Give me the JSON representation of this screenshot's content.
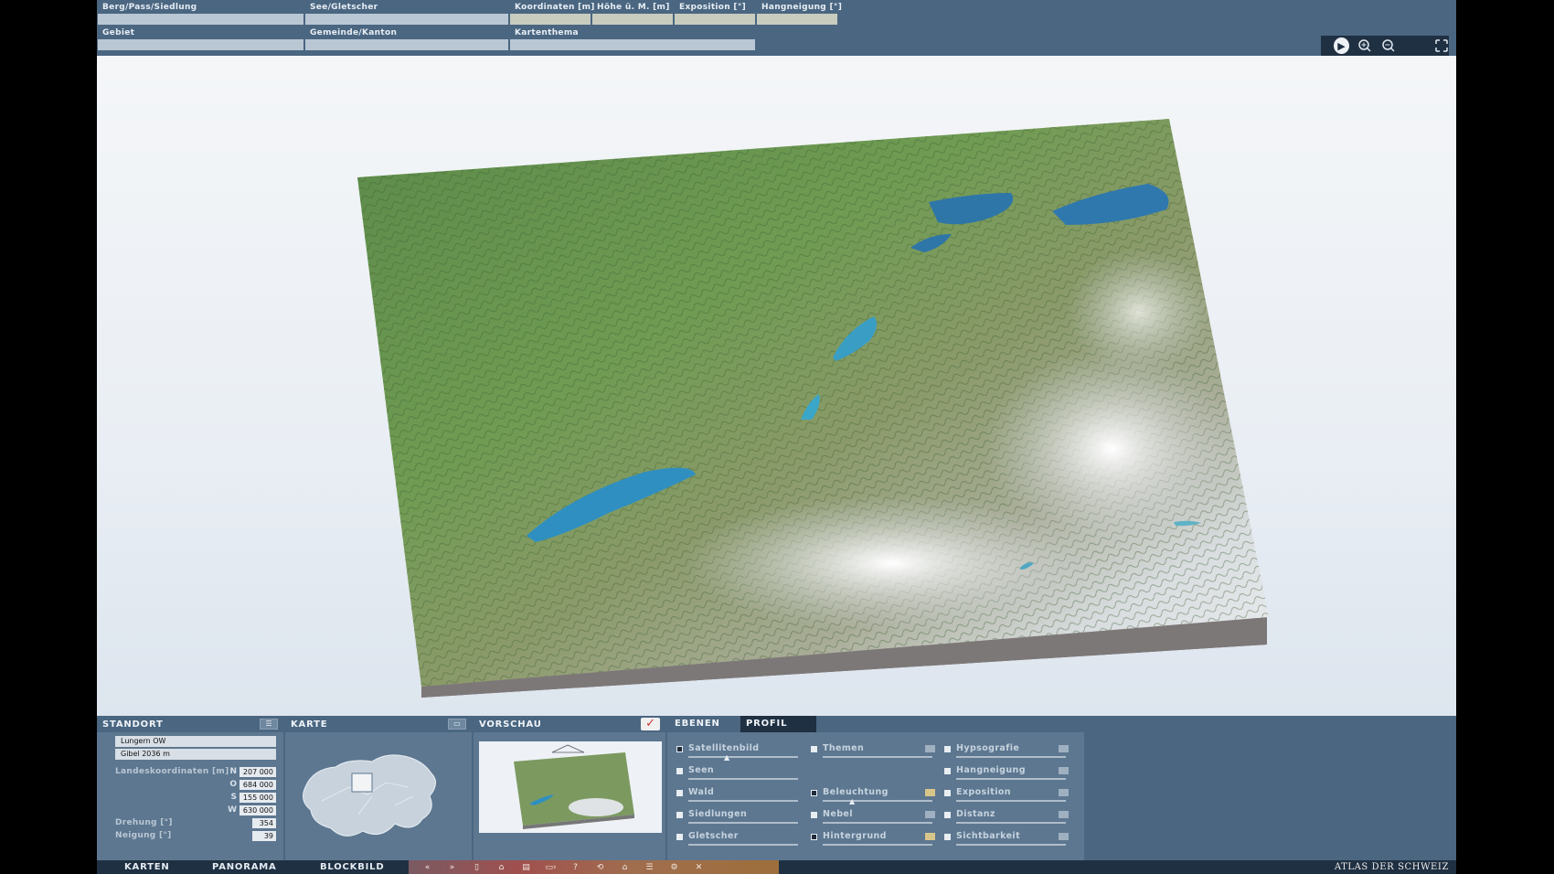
{
  "top": {
    "fields_row1": [
      {
        "label": "Berg/Pass/Siedlung"
      },
      {
        "label": "See/Gletscher"
      },
      {
        "label": "Koordinaten [m]"
      },
      {
        "label": "Höhe ü. M. [m]"
      },
      {
        "label": "Exposition [°]"
      },
      {
        "label": "Hangneigung [°]"
      }
    ],
    "fields_row2": [
      {
        "label": "Gebiet"
      },
      {
        "label": "Gemeinde/Kanton"
      },
      {
        "label": "Kartenthema"
      }
    ],
    "tools": [
      "play-icon",
      "zoom-in-icon",
      "zoom-out-icon",
      "fullscreen-icon"
    ]
  },
  "standort": {
    "title": "STANDORT",
    "place1": "Lungern   OW",
    "place2": "Gibel   2036 m",
    "landeskoord_label": "Landeskoordinaten [m]",
    "coords": [
      {
        "k": "N",
        "v": "207 000"
      },
      {
        "k": "O",
        "v": "684 000"
      },
      {
        "k": "S",
        "v": "155 000"
      },
      {
        "k": "W",
        "v": "630 000"
      }
    ],
    "drehung_label": "Drehung [°]",
    "drehung": "354",
    "neigung_label": "Neigung [°]",
    "neigung": "39"
  },
  "karte": {
    "title": "KARTE"
  },
  "vorschau": {
    "title": "VORSCHAU"
  },
  "ebenen": {
    "tab1": "EBENEN",
    "tab2": "PROFIL",
    "col1": [
      {
        "name": "Satellitenbild",
        "on": true,
        "slider": 0.27
      },
      {
        "name": "Seen",
        "on": false
      },
      {
        "name": "Wald",
        "on": false
      },
      {
        "name": "Siedlungen",
        "on": false
      },
      {
        "name": "Gletscher",
        "on": false
      }
    ],
    "col2": [
      {
        "name": "Themen",
        "on": false,
        "swatch": "grey"
      },
      {
        "name": "Beleuchtung",
        "on": true,
        "swatch": "tan",
        "slider": 0.24
      },
      {
        "name": "Nebel",
        "on": false,
        "swatch": "grey"
      },
      {
        "name": "Hintergrund",
        "on": true,
        "swatch": "tan"
      }
    ],
    "col3": [
      {
        "name": "Hypsografie",
        "on": false
      },
      {
        "name": "Hangneigung",
        "on": false
      },
      {
        "name": "Exposition",
        "on": false
      },
      {
        "name": "Distanz",
        "on": false
      },
      {
        "name": "Sichtbarkeit",
        "on": false
      }
    ]
  },
  "nav": {
    "tabs": [
      "KARTEN",
      "PANORAMA",
      "BLOCKBILD"
    ],
    "brand": "ATLAS DER SCHWEIZ"
  },
  "colors": {
    "panel": "#4a6681",
    "dark": "#1f3042",
    "lake": "#2f8fc0"
  }
}
